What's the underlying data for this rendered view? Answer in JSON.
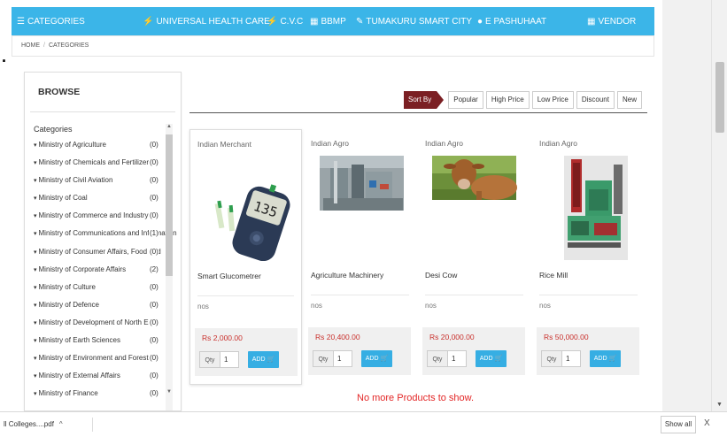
{
  "nav": {
    "items": [
      {
        "icon": "list-icon",
        "glyph": "☰",
        "label": "CATEGORIES"
      },
      {
        "icon": "bolt-icon",
        "glyph": "⚡",
        "label": "UNIVERSAL HEALTH CARE"
      },
      {
        "icon": "bolt-icon",
        "glyph": "⚡",
        "label": "C.V.C"
      },
      {
        "icon": "grid-icon",
        "glyph": "▦",
        "label": "BBMP"
      },
      {
        "icon": "edit-icon",
        "glyph": "✎",
        "label": "TUMAKURU SMART CITY"
      },
      {
        "icon": "circle-icon",
        "glyph": "●",
        "label": "E PASHUHAAT"
      },
      {
        "icon": "grid-icon",
        "glyph": "▦",
        "label": "VENDOR"
      }
    ]
  },
  "breadcrumb": {
    "home": "HOME",
    "sep": "/",
    "current": "CATEGORIES"
  },
  "sidebar": {
    "title": "BROWSE",
    "categories_title": "Categories",
    "categories": [
      {
        "label": "Ministry of Agriculture",
        "count": "(0)"
      },
      {
        "label": "Ministry of Chemicals and Fertilizers",
        "count": "(0)"
      },
      {
        "label": "Ministry of Civil Aviation",
        "count": "(0)"
      },
      {
        "label": "Ministry of Coal",
        "count": "(0)"
      },
      {
        "label": "Ministry of Commerce and Industry",
        "count": "(0)"
      },
      {
        "label": "Ministry of Communications and Information",
        "count": "(1)"
      },
      {
        "label": "Ministry of Consumer Affairs, Food and",
        "count": "(0)"
      },
      {
        "label": "Ministry of Corporate Affairs",
        "count": "(2)"
      },
      {
        "label": "Ministry of Culture",
        "count": "(0)"
      },
      {
        "label": "Ministry of Defence",
        "count": "(0)"
      },
      {
        "label": "Ministry of Development of North East",
        "count": "(0)"
      },
      {
        "label": "Ministry of Earth Sciences",
        "count": "(0)"
      },
      {
        "label": "Ministry of Environment and Forests",
        "count": "(0)"
      },
      {
        "label": "Ministry of External Affairs",
        "count": "(0)"
      },
      {
        "label": "Ministry of Finance",
        "count": "(0)"
      }
    ]
  },
  "sort": {
    "label": "Sort By",
    "options": [
      "Popular",
      "High Price",
      "Low Price",
      "Discount",
      "New"
    ]
  },
  "products": [
    {
      "vendor": "Indian Merchant",
      "name": "Smart Glucometrer",
      "unit": "nos",
      "price": "Rs 2,000.00",
      "qty_label": "Qty",
      "qty": "1",
      "add_label": "ADD"
    },
    {
      "vendor": "Indian Agro",
      "name": "Agriculture Machinery",
      "unit": "nos",
      "price": "Rs 20,400.00",
      "qty_label": "Qty",
      "qty": "1",
      "add_label": "ADD"
    },
    {
      "vendor": "Indian Agro",
      "name": "Desi Cow",
      "unit": "nos",
      "price": "Rs 20,000.00",
      "qty_label": "Qty",
      "qty": "1",
      "add_label": "ADD"
    },
    {
      "vendor": "Indian Agro",
      "name": "Rice Mill",
      "unit": "nos",
      "price": "Rs 50,000.00",
      "qty_label": "Qty",
      "qty": "1",
      "add_label": "ADD"
    }
  ],
  "footer_message": "No more Products to show.",
  "download_bar": {
    "file": "ll Colleges....pdf",
    "caret": "^",
    "show_all": "Show all",
    "close": "X"
  },
  "colors": {
    "nav_bg": "#3bb5e8",
    "sort_bg": "#7b1f23",
    "price": "#c9302c",
    "add_button": "#36aee3",
    "no_more": "#e32626"
  }
}
